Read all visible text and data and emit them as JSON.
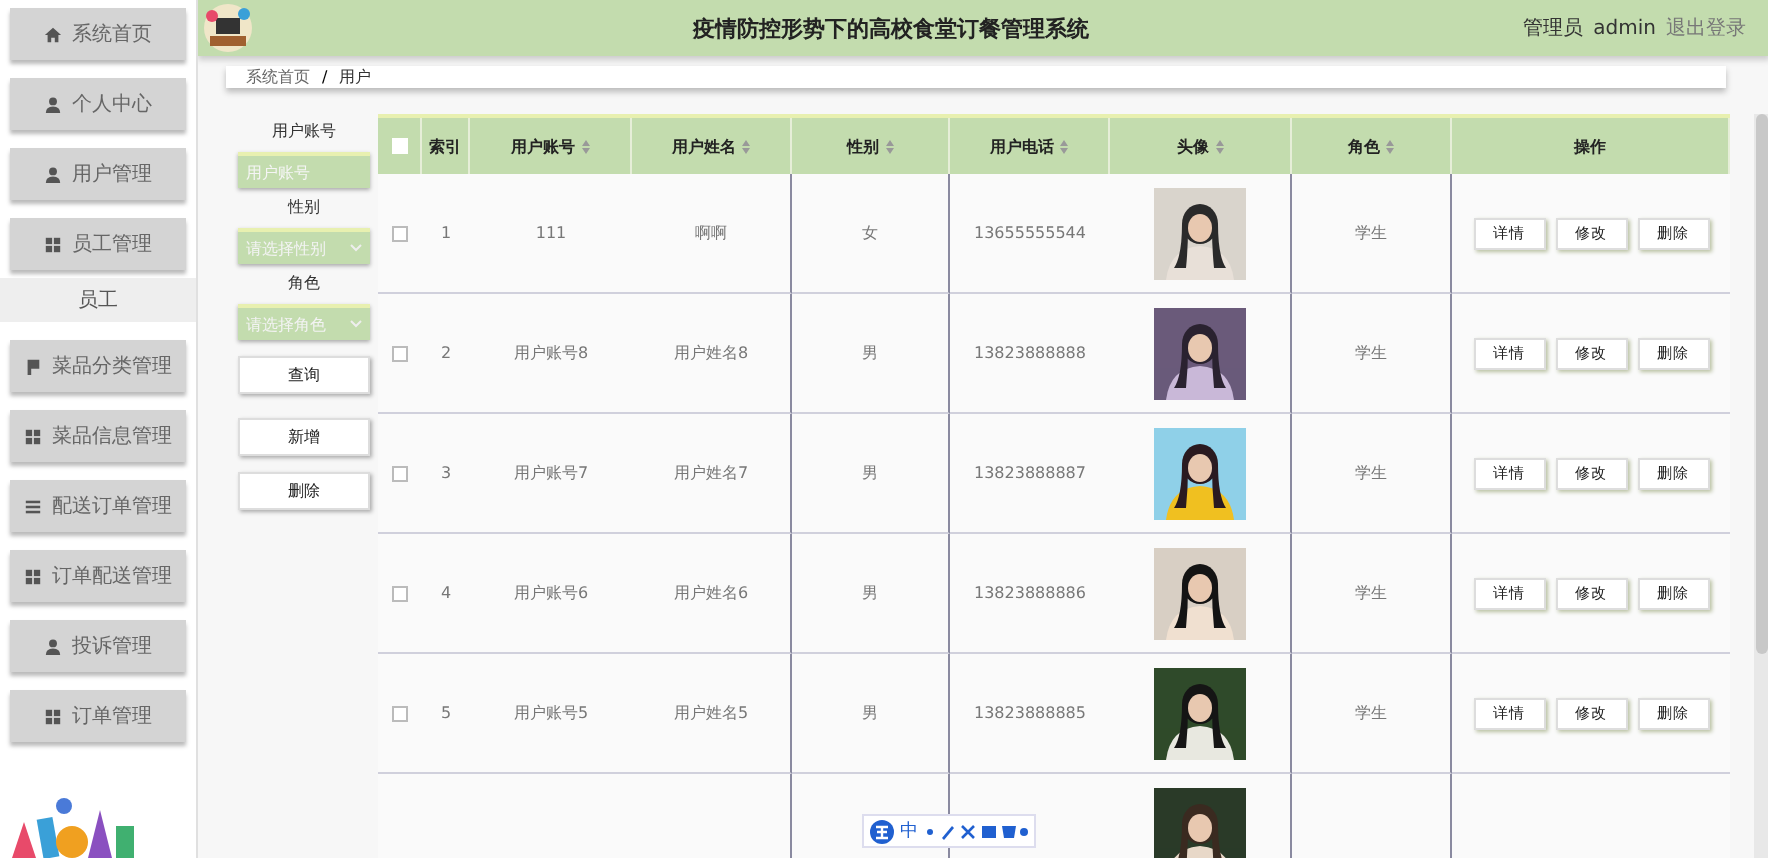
{
  "sidebar": {
    "items": [
      {
        "label": "系统首页",
        "kind": "home"
      },
      {
        "label": "个人中心",
        "kind": "user"
      },
      {
        "label": "用户管理",
        "kind": "user"
      },
      {
        "label": "员工管理",
        "kind": "grid",
        "children": [
          {
            "label": "员工"
          }
        ]
      },
      {
        "label": "菜品分类管理",
        "kind": "flag"
      },
      {
        "label": "菜品信息管理",
        "kind": "grid"
      },
      {
        "label": "配送订单管理",
        "kind": "list"
      },
      {
        "label": "订单配送管理",
        "kind": "grid"
      },
      {
        "label": "投诉管理",
        "kind": "user"
      },
      {
        "label": "订单管理",
        "kind": "grid"
      }
    ]
  },
  "header": {
    "title": "疫情防控形势下的高校食堂订餐管理系统",
    "role": "管理员",
    "user": "admin",
    "logout": "退出登录"
  },
  "breadcrumb": [
    "系统首页",
    "/",
    "用户"
  ],
  "filters": [
    {
      "label": "用户账号",
      "kind": "input",
      "placeholder": "用户账号"
    },
    {
      "label": "性别",
      "kind": "select",
      "placeholder": "请选择性别"
    },
    {
      "label": "角色",
      "kind": "select",
      "placeholder": "请选择角色"
    }
  ],
  "filter_buttons": [
    "查询",
    "新增",
    "删除"
  ],
  "table": {
    "select_all": {
      "checked": false
    },
    "columns": [
      "索引",
      "用户账号",
      "用户姓名",
      "性别",
      "用户电话",
      "头像",
      "角色",
      "操作"
    ],
    "rows": [
      {
        "checked": false,
        "cells": [
          "1",
          "111",
          "啊啊",
          "女",
          "13655555544",
          "",
          "学生"
        ],
        "actions": [
          "详情",
          "修改",
          "删除"
        ]
      },
      {
        "checked": false,
        "cells": [
          "2",
          "用户账号8",
          "用户姓名8",
          "男",
          "13823888888",
          "",
          "学生"
        ],
        "actions": [
          "详情",
          "修改",
          "删除"
        ]
      },
      {
        "checked": false,
        "cells": [
          "3",
          "用户账号7",
          "用户姓名7",
          "男",
          "13823888887",
          "",
          "学生"
        ],
        "actions": [
          "详情",
          "修改",
          "删除"
        ]
      },
      {
        "checked": false,
        "cells": [
          "4",
          "用户账号6",
          "用户姓名6",
          "男",
          "13823888886",
          "",
          "学生"
        ],
        "actions": [
          "详情",
          "修改",
          "删除"
        ]
      },
      {
        "checked": false,
        "cells": [
          "5",
          "用户账号5",
          "用户姓名5",
          "男",
          "13823888885",
          "",
          "学生"
        ],
        "actions": [
          "详情",
          "修改",
          "删除"
        ]
      }
    ]
  },
  "ime_toolbar": {
    "label": "中"
  }
}
